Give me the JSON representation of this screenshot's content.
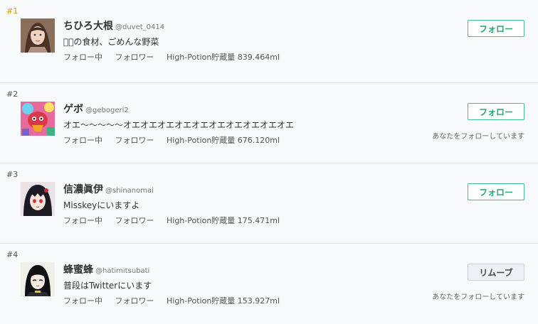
{
  "ranking": [
    {
      "rank": "#1",
      "name": "ちひろ大根",
      "handle": "@duvet_0414",
      "bio": "𫟪罪の食材、ごめんな野菜",
      "following_label": "フォロー中",
      "followers_label": "フォロワー",
      "potion": "High-Potion貯蔵量 839.464ml",
      "button_label": "フォロー",
      "follows_you": ""
    },
    {
      "rank": "#2",
      "name": "ゲボ",
      "handle": "@gebogeri2",
      "bio": "オエ〜〜〜〜〜オエオエオエオエオエオエオエオエオエオエ",
      "following_label": "フォロー中",
      "followers_label": "フォロワー",
      "potion": "High-Potion貯蔵量 676.120ml",
      "button_label": "フォロー",
      "follows_you": "あなたをフォローしています"
    },
    {
      "rank": "#3",
      "name": "信濃眞伊",
      "handle": "@shinanomai",
      "bio": "Misskeyにいますよ",
      "following_label": "フォロー中",
      "followers_label": "フォロワー",
      "potion": "High-Potion貯蔵量 175.471ml",
      "button_label": "フォロー",
      "follows_you": ""
    },
    {
      "rank": "#4",
      "name": "蜂蜜蜂",
      "handle": "@hatimitsubati",
      "bio": "普段はTwitterにいます",
      "following_label": "フォロー中",
      "followers_label": "フォロワー",
      "potion": "High-Potion貯蔵量 153.927ml",
      "button_label": "リムーブ",
      "follows_you": "あなたをフォローしています"
    }
  ],
  "colors": {
    "accent": "#3ec28f",
    "first_rank": "#d4a017"
  }
}
